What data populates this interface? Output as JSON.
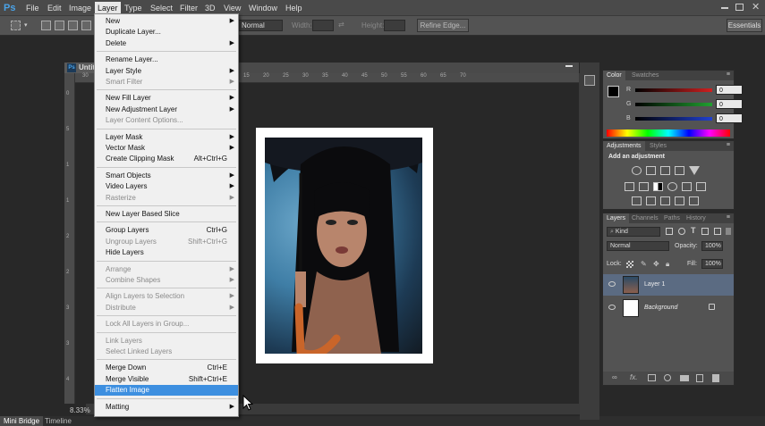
{
  "menubar": {
    "logo": "Ps",
    "items": [
      "File",
      "Edit",
      "Image",
      "Layer",
      "Type",
      "Select",
      "Filter",
      "3D",
      "View",
      "Window",
      "Help"
    ]
  },
  "options": {
    "mode": "Normal",
    "width_label": "Width:",
    "height_label": "Height:",
    "refine_label": "Refine Edge...",
    "workspace": "Essentials"
  },
  "document": {
    "tab_label": "Untit",
    "ps_icon": "Ps",
    "zoom": "8.33%",
    "ruler_marks": [
      "30",
      "25",
      "20",
      "15",
      "10",
      "5",
      "0",
      "5",
      "10",
      "15",
      "20",
      "25",
      "30",
      "35",
      "40",
      "45",
      "50",
      "55",
      "60",
      "65",
      "70"
    ],
    "left_ruler_marks": [
      "0",
      "5",
      "1",
      "1",
      "2",
      "2",
      "3",
      "3",
      "4"
    ]
  },
  "bottom_tabs": [
    "Mini Bridge",
    "Timeline"
  ],
  "color_panel": {
    "tabs": [
      "Color",
      "Swatches"
    ],
    "channels": [
      {
        "letter": "R",
        "value": "0",
        "color": "#d02020"
      },
      {
        "letter": "G",
        "value": "0",
        "color": "#20a030"
      },
      {
        "letter": "B",
        "value": "0",
        "color": "#2040d0"
      }
    ]
  },
  "adjustments_panel": {
    "tabs": [
      "Adjustments",
      "Styles"
    ],
    "heading": "Add an adjustment"
  },
  "layers_panel": {
    "tabs": [
      "Layers",
      "Channels",
      "Paths",
      "History"
    ],
    "kind_label": "Kind",
    "blend_mode": "Normal",
    "opacity_label": "Opacity:",
    "opacity_value": "100%",
    "lock_label": "Lock:",
    "fill_label": "Fill:",
    "fill_value": "100%",
    "layers": [
      {
        "name": "Layer 1",
        "selected": true
      },
      {
        "name": "Background",
        "selected": false
      }
    ],
    "footer_icons": [
      "link-icon",
      "fx-icon",
      "mask-icon",
      "adjustment-icon",
      "folder-icon",
      "new-layer-icon",
      "trash-icon"
    ]
  },
  "layer_menu": {
    "items": [
      {
        "label": "New",
        "arrow": true
      },
      {
        "label": "Duplicate Layer..."
      },
      {
        "label": "Delete",
        "arrow": true
      },
      {
        "sep": true
      },
      {
        "label": "Rename Layer..."
      },
      {
        "label": "Layer Style",
        "arrow": true
      },
      {
        "label": "Smart Filter",
        "arrow": true,
        "disabled": true
      },
      {
        "sep": true
      },
      {
        "label": "New Fill Layer",
        "arrow": true
      },
      {
        "label": "New Adjustment Layer",
        "arrow": true
      },
      {
        "label": "Layer Content Options...",
        "disabled": true
      },
      {
        "sep": true
      },
      {
        "label": "Layer Mask",
        "arrow": true
      },
      {
        "label": "Vector Mask",
        "arrow": true
      },
      {
        "label": "Create Clipping Mask",
        "shortcut": "Alt+Ctrl+G"
      },
      {
        "sep": true
      },
      {
        "label": "Smart Objects",
        "arrow": true
      },
      {
        "label": "Video Layers",
        "arrow": true
      },
      {
        "label": "Rasterize",
        "arrow": true,
        "disabled": true
      },
      {
        "sep": true
      },
      {
        "label": "New Layer Based Slice"
      },
      {
        "sep": true
      },
      {
        "label": "Group Layers",
        "shortcut": "Ctrl+G"
      },
      {
        "label": "Ungroup Layers",
        "shortcut": "Shift+Ctrl+G",
        "disabled": true
      },
      {
        "label": "Hide Layers"
      },
      {
        "sep": true
      },
      {
        "label": "Arrange",
        "arrow": true,
        "disabled": true
      },
      {
        "label": "Combine Shapes",
        "arrow": true,
        "disabled": true
      },
      {
        "sep": true
      },
      {
        "label": "Align Layers to Selection",
        "arrow": true,
        "disabled": true
      },
      {
        "label": "Distribute",
        "arrow": true,
        "disabled": true
      },
      {
        "sep": true
      },
      {
        "label": "Lock All Layers in Group...",
        "disabled": true
      },
      {
        "sep": true
      },
      {
        "label": "Link Layers",
        "disabled": true
      },
      {
        "label": "Select Linked Layers",
        "disabled": true
      },
      {
        "sep": true
      },
      {
        "label": "Merge Down",
        "shortcut": "Ctrl+E"
      },
      {
        "label": "Merge Visible",
        "shortcut": "Shift+Ctrl+E"
      },
      {
        "label": "Flatten Image",
        "selected": true
      },
      {
        "sep": true
      },
      {
        "label": "Matting",
        "arrow": true
      }
    ]
  }
}
